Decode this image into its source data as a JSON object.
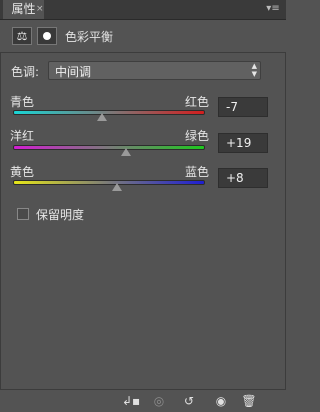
{
  "panel": {
    "tab_title": "属性",
    "close_glyph": "×",
    "menu_glyph": "▾≡"
  },
  "header": {
    "title": "色彩平衡",
    "balance_icon": "scale-icon",
    "mask_icon": "mask-icon"
  },
  "tone": {
    "label": "色调:",
    "value": "中间调"
  },
  "sliders": [
    {
      "left_label": "青色",
      "right_label": "红色",
      "value": "-7",
      "amount": -7
    },
    {
      "left_label": "洋红",
      "right_label": "绿色",
      "value": "+19",
      "amount": 19
    },
    {
      "left_label": "黄色",
      "right_label": "蓝色",
      "value": "+8",
      "amount": 8
    }
  ],
  "preserve_luminosity": {
    "label": "保留明度",
    "checked": false
  },
  "toolbar": {
    "clip_icon": "clip-to-layer-icon",
    "view_prev_icon": "view-previous-icon",
    "reset_icon": "reset-icon",
    "visibility_icon": "eye-icon",
    "delete_icon": "trash-icon"
  }
}
